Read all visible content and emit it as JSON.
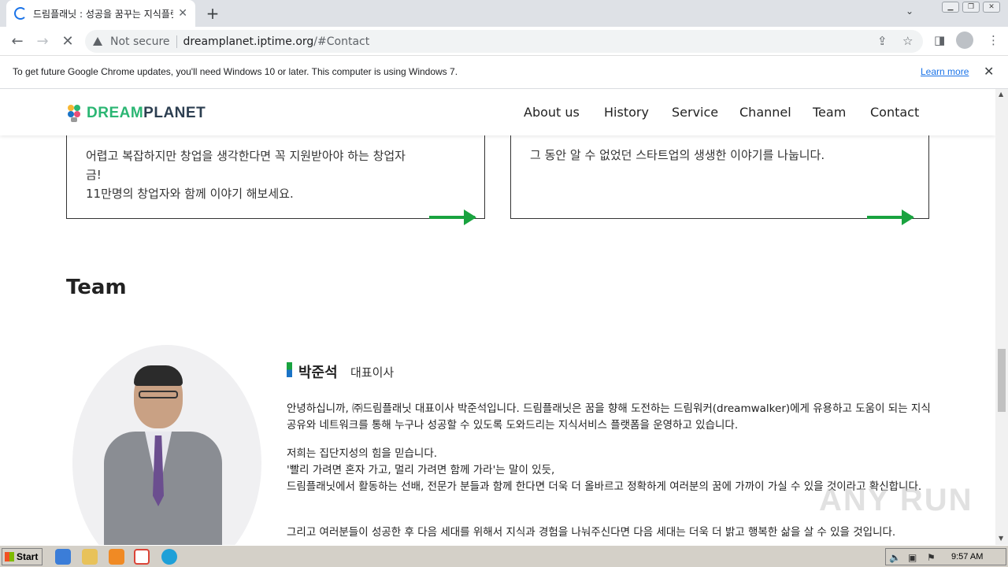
{
  "browser": {
    "tab_title": "드림플래닛 : 성공을 꿈꾸는 지식플랫",
    "new_tab": "+",
    "not_secure": "Not secure",
    "url_host": "dreamplanet.iptime.org",
    "url_path": "/#Contact",
    "infobar_text": "To get future Google Chrome updates, you'll need Windows 10 or later. This computer is using Windows 7.",
    "learn_more": "Learn more"
  },
  "site": {
    "logo_dream": "DREAM",
    "logo_planet": "PLANET",
    "nav": [
      "About us",
      "History",
      "Service",
      "Channel",
      "Team",
      "Contact"
    ],
    "card1_lines": [
      "어렵고 복잡하지만 창업을 생각한다면 꼭 지원받아야 하는 창업자",
      "금!",
      "11만명의 창업자와 함께 이야기 해보세요."
    ],
    "card2_line": "그 동안 알 수 없었던 스타트업의 생생한 이야기를 나눕니다.",
    "team_heading": "Team",
    "member_name": "박준석",
    "member_role": "대표이사",
    "paragraphs": [
      "안녕하십니까, ㈜드림플래닛 대표이사 박준석입니다. 드림플래닛은 꿈을 향해 도전하는 드림워커(dreamwalker)에게 유용하고 도움이 되는 지식공유와 네트워크를 통해 누구나 성공할 수 있도록 도와드리는 지식서비스 플랫폼을 운영하고 있습니다.",
      "저희는 집단지성의 힘을 믿습니다.\n'빨리 가려면 혼자 가고, 멀리 가려면 함께 가라'는 말이 있듯,\n드림플래닛에서 활동하는 선배, 전문가 분들과 함께 한다면 더욱 더 올바르고 정확하게 여러분의 꿈에 가까이 가실 수 있을 것이라고 확신합니다.",
      "그리고 여러분들이 성공한 후 다음 세대를 위해서 지식과 경험을 나눠주신다면 다음 세대는 더욱 더 밝고 행복한 삶을 살 수 있을 것입니다."
    ]
  },
  "watermark": "ANY RUN",
  "taskbar": {
    "start_label": "Start",
    "clock": "9:57 AM"
  }
}
